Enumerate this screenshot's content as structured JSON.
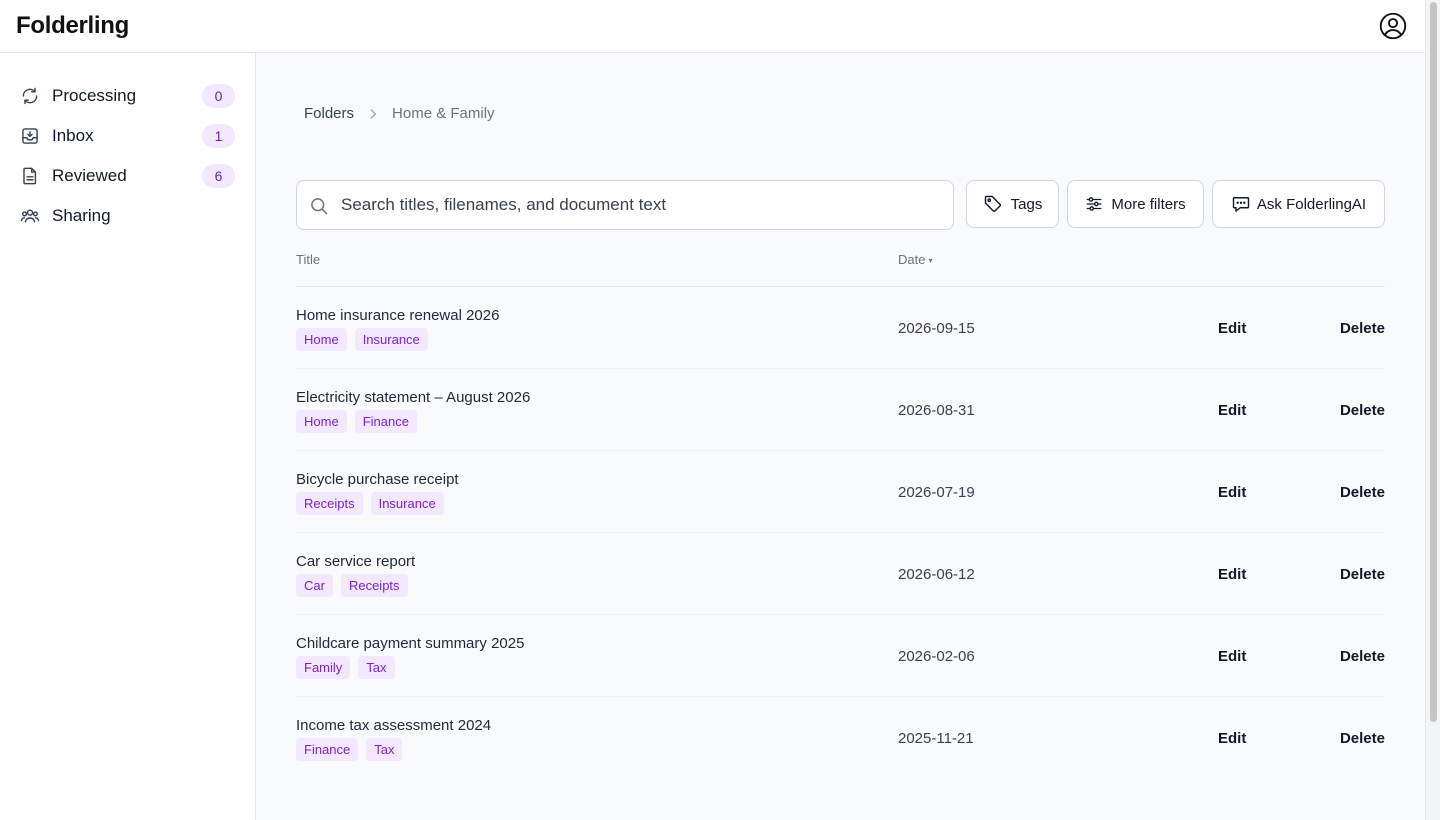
{
  "app": {
    "title": "Folderling"
  },
  "header": {
    "account_icon": "user-circle-icon"
  },
  "sidebar": {
    "items": [
      {
        "label": "Processing",
        "count": "0",
        "icon": "refresh-icon"
      },
      {
        "label": "Inbox",
        "count": "1",
        "icon": "inbox-icon"
      },
      {
        "label": "Reviewed",
        "count": "6",
        "icon": "document-icon"
      },
      {
        "label": "Sharing",
        "count": null,
        "icon": "users-icon"
      }
    ]
  },
  "breadcrumb": {
    "root": "Folders",
    "current": "Home & Family"
  },
  "search": {
    "placeholder": "Search titles, filenames, and document text",
    "value": ""
  },
  "toolbar": {
    "tags_label": "Tags",
    "filters_label": "More filters",
    "ask_label": "Ask FolderlingAI"
  },
  "table": {
    "headers": {
      "title": "Title",
      "date": "Date",
      "sort_indicator": "▾"
    },
    "edit_label": "Edit",
    "delete_label": "Delete",
    "rows": [
      {
        "title": "Home insurance renewal 2026",
        "tags": [
          "Home",
          "Insurance"
        ],
        "date": "2026-09-15"
      },
      {
        "title": "Electricity statement – August 2026",
        "tags": [
          "Home",
          "Finance"
        ],
        "date": "2026-08-31"
      },
      {
        "title": "Bicycle purchase receipt",
        "tags": [
          "Receipts",
          "Insurance"
        ],
        "date": "2026-07-19"
      },
      {
        "title": "Car service report",
        "tags": [
          "Car",
          "Receipts"
        ],
        "date": "2026-06-12"
      },
      {
        "title": "Childcare payment summary 2025",
        "tags": [
          "Family",
          "Tax"
        ],
        "date": "2026-02-06"
      },
      {
        "title": "Income tax assessment 2024",
        "tags": [
          "Finance",
          "Tax"
        ],
        "date": "2025-11-21"
      }
    ]
  },
  "colors": {
    "accent_bg": "#f3e8ff",
    "accent_text": "#7e22ce",
    "border": "#e5e7eb"
  }
}
